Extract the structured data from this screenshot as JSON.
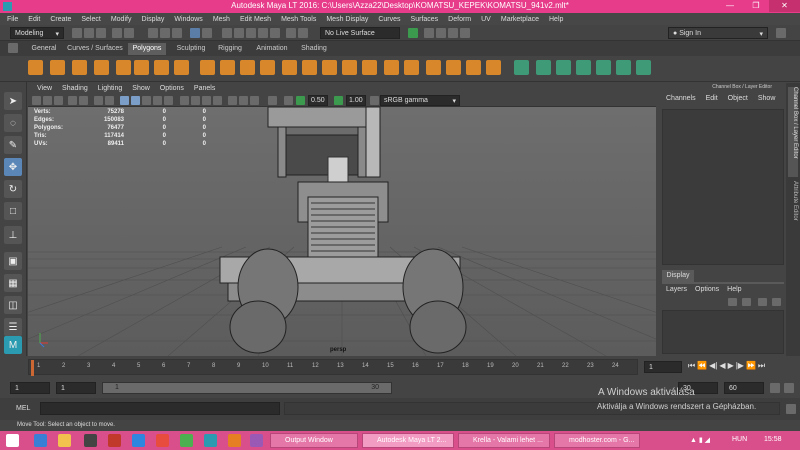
{
  "window": {
    "title": "Autodesk Maya LT 2016: C:\\Users\\Azza22\\Desktop\\KOMATSU_KEPEK\\KOMATSU_941v2.mlt*",
    "min": "—",
    "max": "❐",
    "close": "✕"
  },
  "menu": [
    "File",
    "Edit",
    "Create",
    "Select",
    "Modify",
    "Display",
    "Windows",
    "Mesh",
    "Edit Mesh",
    "Mesh Tools",
    "Mesh Display",
    "Curves",
    "Surfaces",
    "Deform",
    "UV",
    "Marketplace",
    "Help"
  ],
  "statusline": {
    "mode": "Modeling",
    "live_surface": "No Live Surface",
    "sign_in": "Sign In"
  },
  "shelf_tabs": [
    "General",
    "Curves / Surfaces",
    "Polygons",
    "Sculpting",
    "Rigging",
    "Animation",
    "Shading"
  ],
  "shelf_active": "Polygons",
  "viewport": {
    "menu": [
      "View",
      "Shading",
      "Lighting",
      "Show",
      "Options",
      "Panels"
    ],
    "field1": "0.50",
    "field2": "1.00",
    "colorspace": "sRGB gamma",
    "camera": "persp",
    "hud": [
      {
        "label": "Verts:",
        "v1": "75278",
        "v2": "0",
        "v3": "0"
      },
      {
        "label": "Edges:",
        "v1": "150083",
        "v2": "0",
        "v3": "0"
      },
      {
        "label": "Polygons:",
        "v1": "76477",
        "v2": "0",
        "v3": "0"
      },
      {
        "label": "Tris:",
        "v1": "117414",
        "v2": "0",
        "v3": "0"
      },
      {
        "label": "UVs:",
        "v1": "89411",
        "v2": "0",
        "v3": "0"
      }
    ]
  },
  "channel_box": {
    "header": "Channel Box / Layer Editor",
    "menu": [
      "Channels",
      "Edit",
      "Object",
      "Show"
    ],
    "display_tab": "Display",
    "layer_menu": [
      "Layers",
      "Options",
      "Help"
    ]
  },
  "right_strip": {
    "tab1": "Channel Box / Layer Editor",
    "tab2": "Attribute Editor"
  },
  "time_slider": {
    "ticks": [
      "1",
      "2",
      "3",
      "4",
      "5",
      "6",
      "7",
      "8",
      "9",
      "10",
      "11",
      "12",
      "13",
      "14",
      "15",
      "16",
      "17",
      "18",
      "19",
      "20",
      "21",
      "22",
      "23",
      "24"
    ],
    "current": "1"
  },
  "range": {
    "start": "1",
    "start2": "1",
    "range_start": "1",
    "range_end": "30",
    "end": "30",
    "end2": "60"
  },
  "mel_label": "MEL",
  "help_line": "Move Tool: Select an object to move.",
  "watermark": {
    "line1": "A Windows aktiválása",
    "line2": "Aktiválja a Windows rendszert a Gépházban."
  },
  "taskbar": {
    "tasks": [
      "Output Window",
      "Autodesk Maya LT 2...",
      "Krella - Valami lehet ...",
      "modhoster.com - G..."
    ],
    "lang": "HUN",
    "time": "15:58"
  },
  "colors": {
    "titlebar": "#e63c8a",
    "taskbar": "#d94f8c",
    "active_tab": "#5e5e5e"
  }
}
